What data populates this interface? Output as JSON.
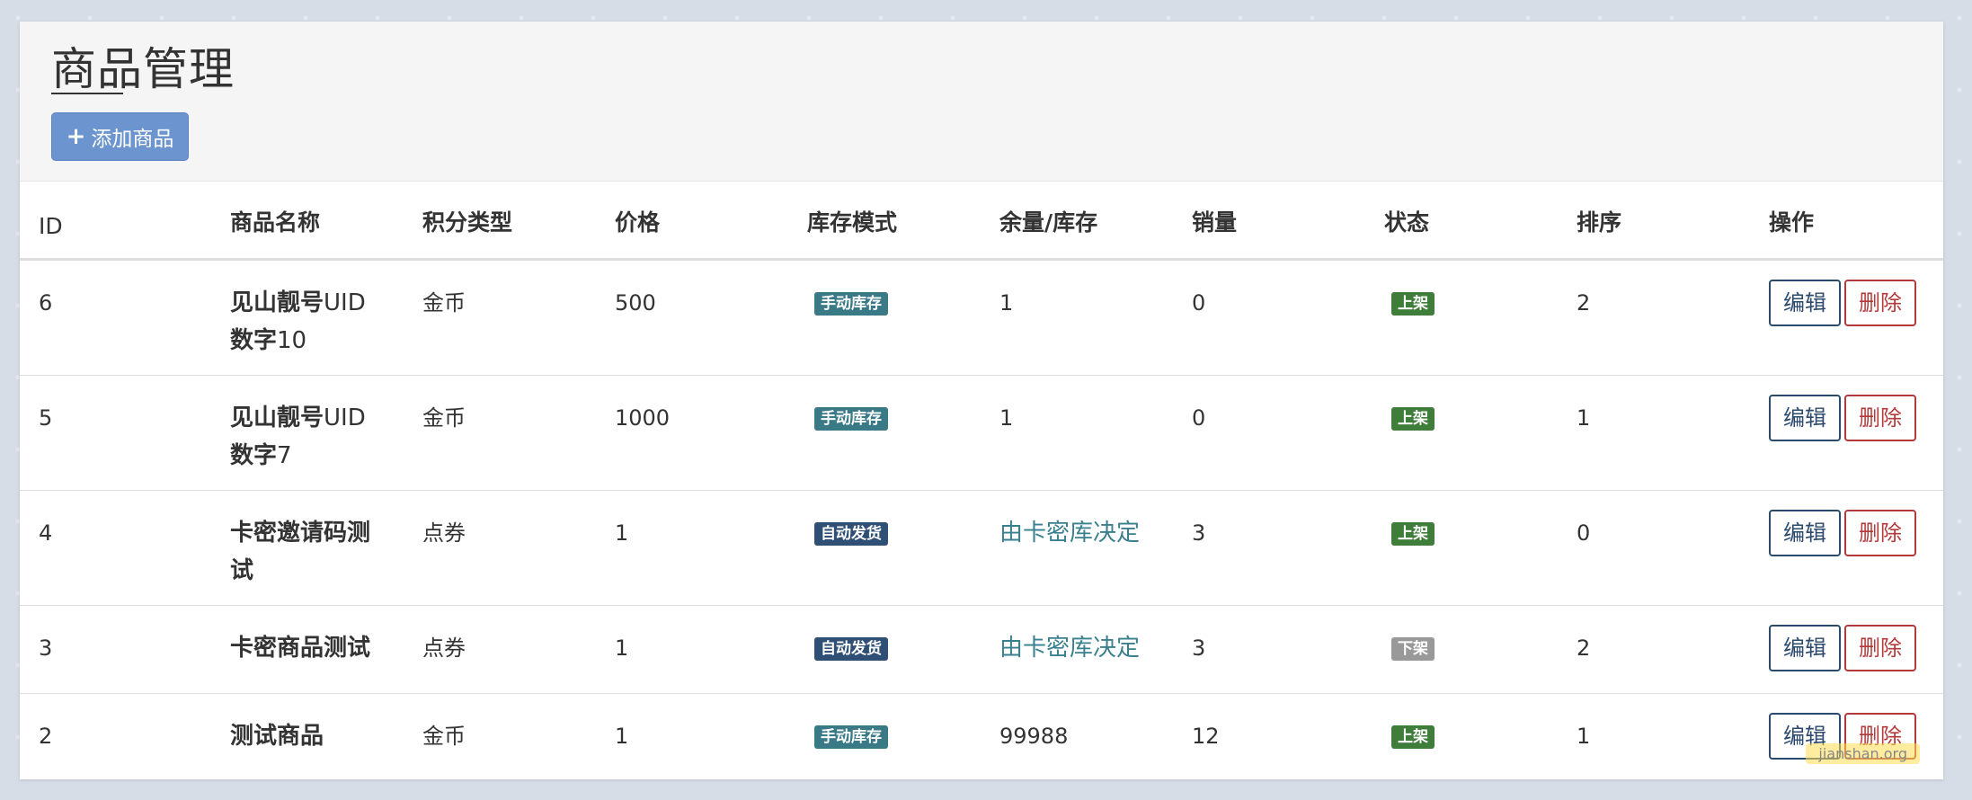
{
  "page": {
    "title": "商品管理",
    "add_button_label": "添加商品"
  },
  "table": {
    "headers": [
      "ID",
      "商品名称",
      "积分类型",
      "价格",
      "库存模式",
      "余量/库存",
      "销量",
      "状态",
      "排序",
      "操作"
    ],
    "rows": [
      {
        "id": "6",
        "name": "见山靓号",
        "name_uid": "UID",
        "name_line2": "数字",
        "name_num": "10",
        "point_type": "金币",
        "price": "500",
        "stock_mode": "手动库存",
        "stock": "1",
        "sales": "0",
        "status": "上架",
        "order": "2"
      },
      {
        "id": "5",
        "name": "见山靓号",
        "name_uid": "UID",
        "name_line2": "数字",
        "name_num": "7",
        "point_type": "金币",
        "price": "1000",
        "stock_mode": "手动库存",
        "stock": "1",
        "sales": "0",
        "status": "上架",
        "order": "1"
      },
      {
        "id": "4",
        "name": "卡密邀请码测",
        "name_line2": "试",
        "point_type": "点券",
        "price": "1",
        "stock_mode": "自动发货",
        "stock": "由卡密库决定",
        "sales": "3",
        "status": "上架",
        "order": "0"
      },
      {
        "id": "3",
        "name": "卡密商品测试",
        "point_type": "点券",
        "price": "1",
        "stock_mode": "自动发货",
        "stock": "由卡密库决定",
        "sales": "3",
        "status": "下架",
        "order": "2"
      },
      {
        "id": "2",
        "name": "测试商品",
        "point_type": "金币",
        "price": "1",
        "stock_mode": "手动库存",
        "stock": "99988",
        "sales": "12",
        "status": "上架",
        "order": "1"
      }
    ],
    "edit_label": "编辑",
    "delete_label": "删除"
  },
  "watermark": "jianshan.org",
  "colors": {
    "accent": "#6c95d0",
    "manual_stock_badge": "#3a7a87",
    "auto_ship_badge": "#2f4f75",
    "on_shelf_badge": "#3f7d3a",
    "off_shelf_badge": "#999999",
    "edit_border": "#2c4a6e",
    "delete_border": "#b33a3a"
  }
}
